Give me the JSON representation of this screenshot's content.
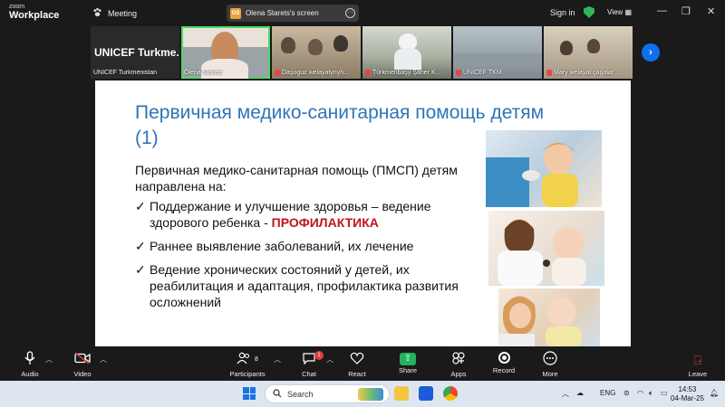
{
  "app": {
    "logo_line1": "zoom",
    "logo_line2": "Workplace"
  },
  "top": {
    "meeting_label": "Meeting",
    "screen_badge": "OS",
    "screen_title": "Olena Starets's screen",
    "sign_in": "Sign in",
    "view": "View"
  },
  "participants": [
    {
      "name": "UNICEF Turkmenistan",
      "big": "UNICEF  Turkme...",
      "muted": false
    },
    {
      "name": "Olena Starets",
      "muted": false,
      "active": true
    },
    {
      "name": "Daşoguz welaýatynyň...",
      "muted": true
    },
    {
      "name": "Türkmenbaşy Şäher K...",
      "muted": true
    },
    {
      "name": "UNICEF TKM",
      "muted": true
    },
    {
      "name": "Mary welaýat çagalar ...",
      "muted": true
    }
  ],
  "slide": {
    "title": "Первичная медико-санитарная помощь детям (1)",
    "intro": "Первичная медико-санитарная помощь (ПМСП) детям направлена на:",
    "bullets": [
      {
        "text": "Поддержание и улучшение здоровья – ведение здорового ребенка - ",
        "emphasis": "ПРОФИЛАКТИКА"
      },
      {
        "text": "Раннее выявление заболеваний, их лечение",
        "emphasis": ""
      },
      {
        "text": "Ведение хронических состояний у детей, их реабилитация и адаптация,  профилактика развития осложнений",
        "emphasis": ""
      }
    ],
    "check": "✓"
  },
  "controls": {
    "audio": "Audio",
    "video": "Video",
    "participants": "Participants",
    "participants_count": "8",
    "chat": "Chat",
    "chat_badge": "1",
    "react": "React",
    "share": "Share",
    "apps": "Apps",
    "record": "Record",
    "more": "More",
    "leave": "Leave"
  },
  "taskbar": {
    "search_placeholder": "Search",
    "language": "ENG",
    "time": "14:53",
    "date": "04-Mar-25"
  },
  "colors": {
    "accent": "#0e71eb",
    "title_blue": "#2e75b6",
    "emphasis_red": "#c0141c",
    "active_green": "#4cd964"
  }
}
